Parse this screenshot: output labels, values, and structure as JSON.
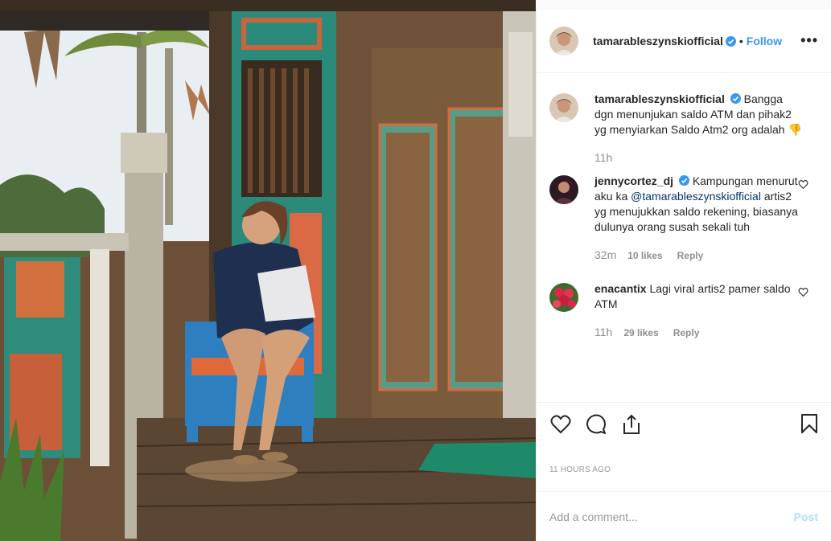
{
  "post": {
    "author": "tamarableszynskiofficial",
    "follow_label": "Follow",
    "separator": "•",
    "more_label": "•••"
  },
  "comments": [
    {
      "user": "tamarableszynskiofficial",
      "verified": true,
      "text": "Bangga dgn menunjukan saldo ATM dan pihak2 yg menyiarkan Saldo Atm2 org adalah 👎",
      "time": "11h"
    },
    {
      "user": "jennycortez_dj",
      "verified": true,
      "text_before": "Kampungan menurut aku ka",
      "mention": "@tamarableszynskiofficial",
      "text_after": "artis2 yg menujukkan saldo rekening, biasanya dulunya orang susah sekali tuh",
      "time": "32m",
      "likes": "10 likes",
      "reply_label": "Reply"
    },
    {
      "user": "enacantix",
      "verified": false,
      "text": "Lagi viral artis2 pamer saldo ATM",
      "time": "11h",
      "likes": "29 likes",
      "reply_label": "Reply"
    }
  ],
  "actions": {
    "icons": [
      "heart-icon",
      "comment-icon",
      "share-icon",
      "bookmark-icon"
    ]
  },
  "timestamp": "11 HOURS AGO",
  "add_comment": {
    "placeholder": "Add a comment...",
    "post_label": "Post"
  },
  "colors": {
    "accent": "#3897f0",
    "post_disabled": "#b2dffc",
    "muted": "#8e8e8e"
  }
}
